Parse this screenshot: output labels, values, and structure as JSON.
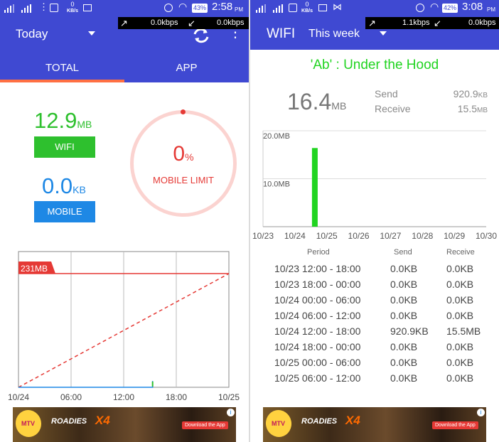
{
  "left": {
    "status": {
      "net_speed": "0",
      "net_unit": "KB/s",
      "battery": "43%",
      "time": "2:58",
      "ampm": "PM"
    },
    "speedbar": {
      "up": "0.0kbps",
      "down": "0.0kbps"
    },
    "toolbar": {
      "period": "Today"
    },
    "tabs": [
      {
        "label": "TOTAL",
        "active": true
      },
      {
        "label": "APP",
        "active": false
      }
    ],
    "wifi": {
      "value": "12.9",
      "unit": "MB",
      "label": "WIFI"
    },
    "mobile": {
      "value": "0.0",
      "unit": "KB",
      "label": "MOBILE"
    },
    "limit": {
      "percent": "0",
      "sign": "%",
      "label": "MOBILE LIMIT"
    },
    "chart_data": {
      "type": "line",
      "annotation": "231MB",
      "x_ticks": [
        "10/24",
        "06:00",
        "12:00",
        "18:00",
        "10/25"
      ],
      "limit_value_mb": 231,
      "series": [
        {
          "values": [
            [
              0,
              0
            ],
            [
              24,
              231
            ]
          ],
          "style": "dashed",
          "color": "#e53935"
        },
        {
          "values": [
            [
              0,
              0
            ],
            [
              15.3,
              0
            ],
            [
              15.3,
              12.9
            ]
          ],
          "color": "#1e88e5"
        }
      ]
    }
  },
  "right": {
    "status": {
      "net_speed": "0",
      "net_unit": "KB/s",
      "battery": "42%",
      "time": "3:08",
      "ampm": "PM"
    },
    "speedbar": {
      "up": "1.1kbps",
      "down": "0.0kbps"
    },
    "toolbar": {
      "title": "WIFI",
      "period": "This week"
    },
    "app_title": "'Ab' : Under the Hood",
    "summary": {
      "total": "16.4",
      "total_unit": "MB",
      "send_label": "Send",
      "send_value": "920.9",
      "send_unit": "KB",
      "receive_label": "Receive",
      "receive_value": "15.5",
      "receive_unit": "MB"
    },
    "chart_data": {
      "type": "bar",
      "categories": [
        "10/23",
        "10/24",
        "10/25",
        "10/26",
        "10/27",
        "10/28",
        "10/29",
        "10/30"
      ],
      "y_ticks": [
        "20.0MB",
        "10.0MB"
      ],
      "ylim": [
        0,
        20
      ],
      "bars": [
        {
          "x": "10/24 12:00",
          "value": 16.4
        }
      ],
      "color": "#21d421"
    },
    "table": {
      "headers": [
        "Period",
        "Send",
        "Receive"
      ],
      "rows": [
        [
          "10/23 12:00 - 18:00",
          "0.0KB",
          "0.0KB"
        ],
        [
          "10/23 18:00 - 00:00",
          "0.0KB",
          "0.0KB"
        ],
        [
          "10/24 00:00 - 06:00",
          "0.0KB",
          "0.0KB"
        ],
        [
          "10/24 06:00 - 12:00",
          "0.0KB",
          "0.0KB"
        ],
        [
          "10/24 12:00 - 18:00",
          "920.9KB",
          "15.5MB"
        ],
        [
          "10/24 18:00 - 00:00",
          "0.0KB",
          "0.0KB"
        ],
        [
          "10/25 00:00 - 06:00",
          "0.0KB",
          "0.0KB"
        ],
        [
          "10/25 06:00 - 12:00",
          "0.0KB",
          "0.0KB"
        ]
      ]
    }
  },
  "ad": {
    "brand": "ROADIES",
    "edition": "X4",
    "cta": "Download the App",
    "sponsor": "MTV",
    "info": "i"
  },
  "colors": {
    "primary": "#3f49d2",
    "accent": "#ff7043",
    "wifi": "#2ec02e",
    "mobile": "#1e88e5",
    "limit": "#e53935",
    "green_text": "#21d421"
  }
}
